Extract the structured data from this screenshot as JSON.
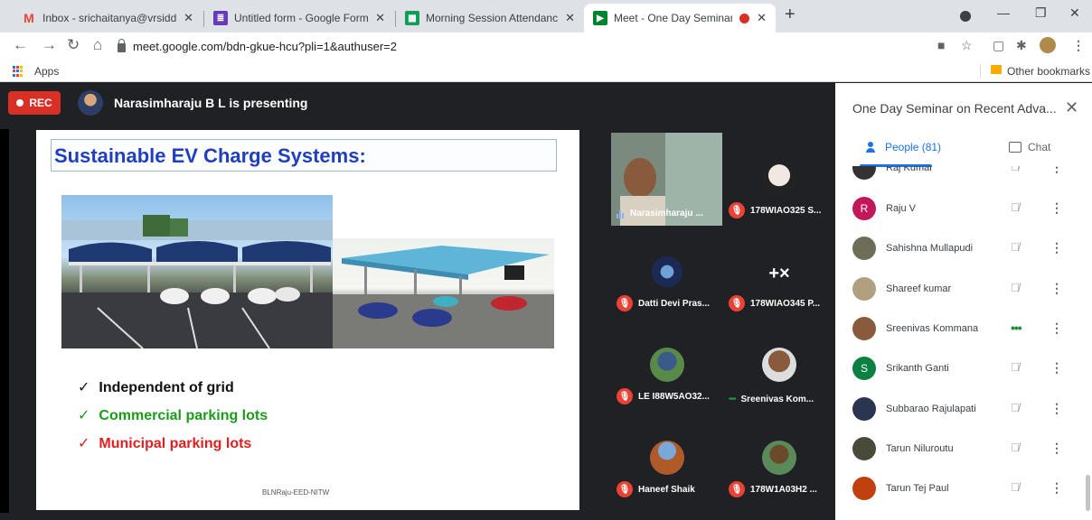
{
  "browser": {
    "tabs": [
      {
        "title": "Inbox - srichaitanya@vrsiddharth",
        "icon": "gmail-icon",
        "color": "#ea4335"
      },
      {
        "title": "Untitled form - Google Forms",
        "icon": "forms-icon",
        "color": "#673ab7"
      },
      {
        "title": "Morning Session Attendance - G",
        "icon": "sheets-icon",
        "color": "#0f9d58"
      },
      {
        "title": "Meet - One Day Seminar on",
        "icon": "meet-icon",
        "color": "#00832d"
      }
    ],
    "url": "meet.google.com/bdn-gkue-hcu?pli=1&authuser=2",
    "apps_label": "Apps",
    "other_bookmarks": "Other bookmarks"
  },
  "meet": {
    "rec_label": "REC",
    "presenting_text": "Narasimharaju B L is presenting",
    "slide": {
      "title": "Sustainable EV Charge Systems:",
      "bullets": [
        {
          "text": "Independent of grid",
          "color": "#111111"
        },
        {
          "text": "Commercial parking lots",
          "color": "#1a9c1a"
        },
        {
          "text": "Municipal parking lots",
          "color": "#e02020"
        }
      ],
      "footer": "BLNRaju-EED-NITW"
    },
    "tiles": [
      {
        "name": "Narasimharaju ...",
        "status": "speaking"
      },
      {
        "name": "178WIAO325 S...",
        "status": "muted"
      },
      {
        "name": "Datti Devi Pras...",
        "status": "muted"
      },
      {
        "name": "178WIAO345 P...",
        "status": "muted"
      },
      {
        "name": "LE I88W5AO32...",
        "status": "muted"
      },
      {
        "name": "Sreenivas Kom...",
        "status": "active"
      },
      {
        "name": "Haneef Shaik",
        "status": "muted"
      },
      {
        "name": "178W1A03H2 ...",
        "status": "muted"
      }
    ]
  },
  "panel": {
    "title": "One Day Seminar on Recent Adva...",
    "people_tab": "People (81)",
    "chat_tab": "Chat",
    "participants": [
      {
        "name": "Raj Kumar",
        "initial": "",
        "color": "#333333",
        "mic": "muted"
      },
      {
        "name": "Raju V",
        "initial": "R",
        "color": "#c2185b",
        "mic": "muted"
      },
      {
        "name": "Sahishna Mullapudi",
        "initial": "",
        "color": "#6d6d5a",
        "mic": "muted"
      },
      {
        "name": "Shareef kumar",
        "initial": "",
        "color": "#b0a080",
        "mic": "muted"
      },
      {
        "name": "Sreenivas Kommana",
        "initial": "",
        "color": "#8a5a3c",
        "mic": "active"
      },
      {
        "name": "Srikanth Ganti",
        "initial": "S",
        "color": "#0b8043",
        "mic": "muted"
      },
      {
        "name": "Subbarao Rajulapati",
        "initial": "",
        "color": "#2b3550",
        "mic": "muted"
      },
      {
        "name": "Tarun Niluroutu",
        "initial": "",
        "color": "#4a4a3a",
        "mic": "muted"
      },
      {
        "name": "Tarun Tej Paul",
        "initial": "",
        "color": "#c04010",
        "mic": "muted"
      }
    ]
  }
}
